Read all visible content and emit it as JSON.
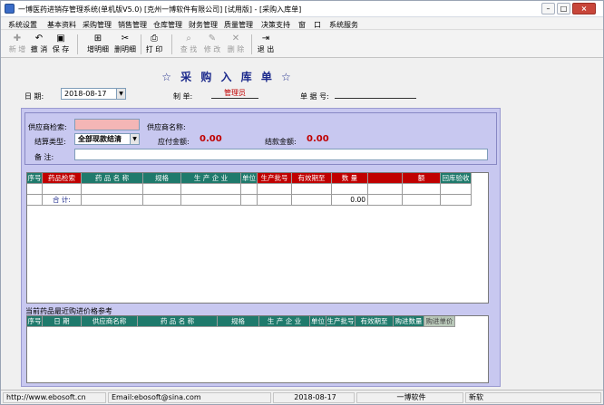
{
  "window": {
    "title": "一博医药进销存管理系统(单机版V5.0)   [克州一博软件有限公司]   [试用版]  - [采购入库单]",
    "controls": {
      "minimize": "–",
      "maximize": "□",
      "close": "×"
    }
  },
  "menu": [
    "系统设置",
    "基本资料",
    "采购管理",
    "销售管理",
    "仓库管理",
    "财务管理",
    "质量管理",
    "决策支持",
    "窗",
    "口",
    "系统服务"
  ],
  "toolbar": [
    {
      "label": "新 增",
      "icon": "✚",
      "disabled": true
    },
    {
      "label": "撤 消",
      "icon": "↶",
      "disabled": false
    },
    {
      "label": "保 存",
      "icon": "▣",
      "disabled": false
    },
    {
      "label": "增明细",
      "icon": "⊞",
      "disabled": false
    },
    {
      "label": "删明细",
      "icon": "✂",
      "disabled": false
    },
    {
      "label": "打 印",
      "icon": "⎙",
      "disabled": false
    },
    {
      "label": "查 找",
      "icon": "⌕",
      "disabled": true
    },
    {
      "label": "修 改",
      "icon": "✎",
      "disabled": true
    },
    {
      "label": "删 除",
      "icon": "✕",
      "disabled": true
    },
    {
      "label": "退 出",
      "icon": "⇥",
      "disabled": false
    }
  ],
  "form": {
    "title": "☆  采 购 入 库 单  ☆",
    "date_label": "日  期:",
    "date_value": "2018-08-17",
    "maker_label": "制    单:",
    "maker_value": "管理员",
    "docno_label": "单 据 号:",
    "docno_value": ""
  },
  "header": {
    "supplier_search_label": "供应商检索:",
    "supplier_search_value": "",
    "supplier_name_label": "供应商名称:",
    "supplier_name_value": "",
    "settle_label": "结算类型:",
    "settle_value": "全部现款结清",
    "payable_label": "应付金额:",
    "payable_value": "0.00",
    "settled_label": "结款金额:",
    "settled_value": "0.00",
    "remark_label": "备    注:",
    "remark_value": ""
  },
  "main_grid": {
    "columns": [
      {
        "label": "序号",
        "style": "teal"
      },
      {
        "label": "药品检索",
        "style": "red"
      },
      {
        "label": "药 品 名 称",
        "style": "teal"
      },
      {
        "label": "规格",
        "style": "teal"
      },
      {
        "label": "生 产 企 业",
        "style": "teal"
      },
      {
        "label": "单位",
        "style": "teal"
      },
      {
        "label": "生产批号",
        "style": "red"
      },
      {
        "label": "有效期至",
        "style": "red"
      },
      {
        "label": "数 量",
        "style": "red"
      },
      {
        "label": "",
        "style": "red"
      },
      {
        "label": "额",
        "style": "red"
      },
      {
        "label": "回库验收",
        "style": "teal"
      }
    ],
    "total_label": "合 计:",
    "total_amount": "0.00"
  },
  "history": {
    "label": "当前药品最近购进价格参考",
    "columns": [
      "序号",
      "日  期",
      "供应商名称",
      "药 品 名 称",
      "规格",
      "生 产 企 业",
      "单位",
      "生产批号",
      "有效期至",
      "购进数量",
      "购进单价"
    ]
  },
  "status": {
    "url": "http://www.ebosoft.cn",
    "email": "Email:ebosoft@sina.com",
    "date": "2018-08-17",
    "company": "一博软件",
    "version": "新软"
  }
}
